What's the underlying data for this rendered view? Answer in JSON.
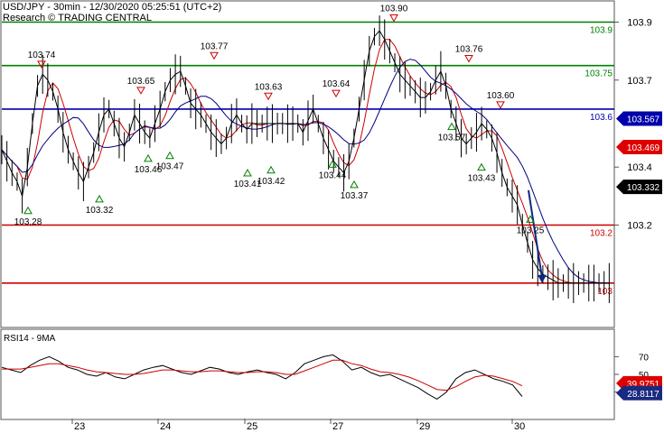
{
  "header": {
    "title": "USD/JPY - 30min - 12/30/2020 05:25:51 (UTC+2)",
    "subtitle": "Research © TRADING CENTRAL"
  },
  "colors": {
    "price": "#000000",
    "ma_fast": "#cc0000",
    "ma_slow": "#000080",
    "resistance": "#008000",
    "pivot": "#0000aa",
    "support": "#cc0000",
    "rsi": "#000000",
    "rsi_ma": "#cc0000",
    "forecast": "#0b2a80",
    "badge_pivot": "#0000aa",
    "badge_support": "#dd0000",
    "badge_last": "#000000",
    "badge_rsi": "#1a2a80",
    "badge_rsi_ma": "#dd0000"
  },
  "chart_data": [
    {
      "type": "line",
      "title": "USD/JPY - 30min",
      "ylim": [
        102.85,
        103.97
      ],
      "y_ticks": [
        "103.9",
        "103.7",
        "103.4",
        "103.2"
      ],
      "x_ticks": [
        "23",
        "24",
        "25",
        "27",
        "29",
        "30"
      ],
      "series": [
        {
          "role": "price",
          "x": [
            0,
            2,
            4,
            6,
            8,
            10,
            12,
            14,
            16,
            18,
            20,
            22,
            24,
            26,
            28,
            30,
            32,
            34,
            36,
            38,
            40,
            42,
            44,
            46,
            48,
            50,
            52,
            54,
            56,
            58,
            60,
            62,
            64,
            66,
            68,
            70,
            72,
            74,
            76,
            78,
            80,
            82,
            84,
            86,
            88,
            90,
            92,
            94,
            96,
            98,
            100,
            102,
            104,
            106,
            108,
            110,
            112,
            114,
            116,
            118,
            120,
            122,
            124,
            126,
            128,
            130,
            132,
            134,
            136,
            138,
            140,
            142,
            144,
            146,
            148,
            150,
            152,
            154,
            156,
            158,
            160,
            162,
            164,
            166,
            168,
            170,
            172,
            174,
            176,
            178,
            180,
            182,
            184,
            186,
            188,
            190,
            192,
            194,
            196,
            198,
            200,
            202,
            204,
            206,
            208,
            210,
            212,
            214,
            216,
            218,
            220,
            222,
            224,
            226,
            228,
            230,
            232,
            234,
            236,
            238
          ],
          "values": [
            103.46,
            103.42,
            103.38,
            103.35,
            103.3,
            103.4,
            103.55,
            103.68,
            103.72,
            103.7,
            103.66,
            103.6,
            103.52,
            103.46,
            103.42,
            103.38,
            103.35,
            103.4,
            103.45,
            103.52,
            103.58,
            103.6,
            103.55,
            103.5,
            103.47,
            103.52,
            103.58,
            103.55,
            103.52,
            103.5,
            103.55,
            103.6,
            103.66,
            103.7,
            103.72,
            103.73,
            103.68,
            103.62,
            103.6,
            103.58,
            103.55,
            103.52,
            103.5,
            103.48,
            103.5,
            103.55,
            103.58,
            103.55,
            103.53,
            103.55,
            103.55,
            103.55,
            103.55,
            103.55,
            103.55,
            103.55,
            103.55,
            103.55,
            103.55,
            103.52,
            103.56,
            103.6,
            103.55,
            103.5,
            103.46,
            103.42,
            103.4,
            103.38,
            103.42,
            103.5,
            103.6,
            103.7,
            103.8,
            103.85,
            103.87,
            103.84,
            103.8,
            103.76,
            103.72,
            103.7,
            103.68,
            103.66,
            103.64,
            103.64,
            103.66,
            103.7,
            103.73,
            103.68,
            103.6,
            103.55,
            103.5,
            103.48,
            103.5,
            103.52,
            103.55,
            103.53,
            103.5,
            103.45,
            103.38,
            103.33,
            103.3,
            103.27,
            103.2,
            103.14,
            103.08,
            103.05,
            103.03,
            103.02,
            103.01,
            103.0,
            103.0,
            103.0,
            103.0,
            103.0,
            103.0,
            103.0,
            103.0,
            103.0,
            103.0,
            103.0
          ],
          "note": "close approximations sampled along time axis (units: half-hour bars)"
        }
      ],
      "levels": [
        {
          "label": "103.9",
          "value": 103.9,
          "role": "resistance"
        },
        {
          "label": "103.75",
          "value": 103.75,
          "role": "resistance"
        },
        {
          "label": "103.6",
          "value": 103.6,
          "role": "pivot"
        },
        {
          "label": "103.2",
          "value": 103.2,
          "role": "support"
        },
        {
          "label": "103",
          "value": 103.0,
          "role": "support"
        }
      ],
      "annotations_peaks": [
        {
          "label": "103.74",
          "value": 103.74
        },
        {
          "label": "103.65",
          "value": 103.65
        },
        {
          "label": "103.77",
          "value": 103.77
        },
        {
          "label": "103.63",
          "value": 103.63
        },
        {
          "label": "103.64",
          "value": 103.64
        },
        {
          "label": "103.90",
          "value": 103.9
        },
        {
          "label": "103.76",
          "value": 103.76
        },
        {
          "label": "103.60",
          "value": 103.6
        }
      ],
      "annotations_troughs": [
        {
          "label": "103.28",
          "value": 103.28
        },
        {
          "label": "103.32",
          "value": 103.32
        },
        {
          "label": "103.46",
          "value": 103.46
        },
        {
          "label": "103.47",
          "value": 103.47
        },
        {
          "label": "103.41",
          "value": 103.41
        },
        {
          "label": "103.42",
          "value": 103.42
        },
        {
          "label": "103.44",
          "value": 103.44
        },
        {
          "label": "103.37",
          "value": 103.37
        },
        {
          "label": "103.57",
          "value": 103.57
        },
        {
          "label": "103.43",
          "value": 103.43
        },
        {
          "label": "103.25",
          "value": 103.25
        }
      ],
      "badges": [
        {
          "label": "103.567",
          "value": 103.567,
          "role": "pivot"
        },
        {
          "label": "103.469",
          "value": 103.469,
          "role": "support"
        },
        {
          "label": "103.332",
          "value": 103.332,
          "role": "last"
        }
      ]
    },
    {
      "type": "line",
      "title": "RSI14 - 9MA",
      "ylim": [
        0,
        100
      ],
      "y_ticks": [
        "70",
        "50",
        "30"
      ],
      "series": [
        {
          "name": "RSI14",
          "values": [
            58,
            55,
            52,
            60,
            66,
            70,
            65,
            58,
            55,
            50,
            48,
            52,
            47,
            45,
            50,
            55,
            58,
            60,
            56,
            52,
            50,
            54,
            58,
            56,
            52,
            50,
            53,
            55,
            52,
            50,
            45,
            52,
            62,
            66,
            70,
            72,
            65,
            55,
            58,
            52,
            48,
            50,
            45,
            40,
            35,
            28,
            22,
            30,
            45,
            52,
            55,
            50,
            45,
            42,
            38,
            25
          ]
        },
        {
          "name": "9MA",
          "values": [
            56,
            56,
            56,
            58,
            60,
            62,
            62,
            60,
            58,
            55,
            53,
            52,
            51,
            50,
            50,
            51,
            53,
            55,
            55,
            54,
            53,
            53,
            54,
            54,
            53,
            52,
            52,
            53,
            53,
            52,
            50,
            50,
            54,
            58,
            62,
            66,
            66,
            62,
            60,
            56,
            53,
            52,
            50,
            47,
            43,
            38,
            33,
            32,
            36,
            42,
            47,
            49,
            48,
            45,
            42,
            37
          ]
        }
      ],
      "badges": [
        {
          "label": "39.9751",
          "value": 39.9751,
          "role": "rsi_ma"
        },
        {
          "label": "28.8117",
          "value": 28.8117,
          "role": "rsi"
        }
      ]
    }
  ]
}
